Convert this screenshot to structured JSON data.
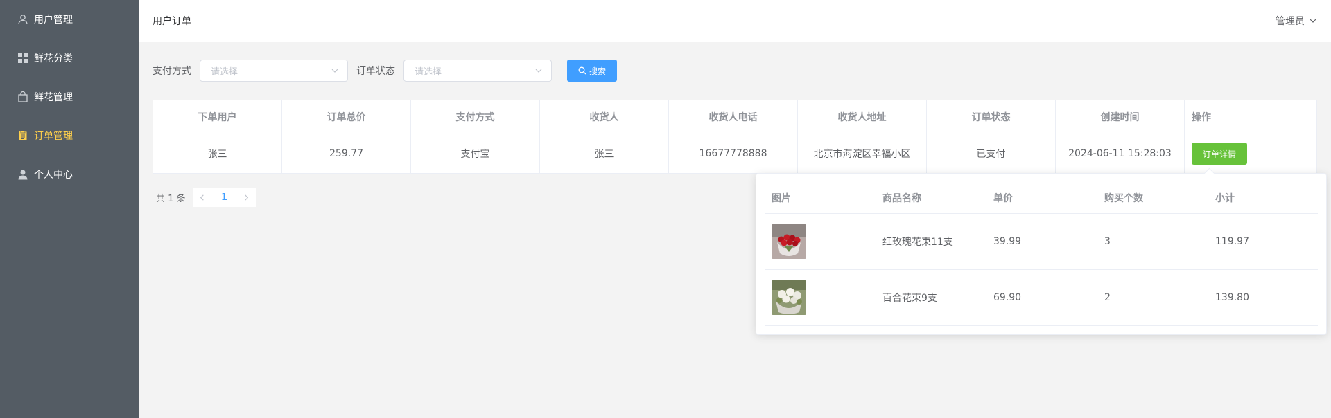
{
  "sidebar": {
    "items": [
      {
        "label": "用户管理",
        "icon": "user-icon",
        "active": false
      },
      {
        "label": "鲜花分类",
        "icon": "grid-icon",
        "active": false
      },
      {
        "label": "鲜花管理",
        "icon": "bag-icon",
        "active": false
      },
      {
        "label": "订单管理",
        "icon": "clipboard-icon",
        "active": true
      },
      {
        "label": "个人中心",
        "icon": "person-icon",
        "active": false
      }
    ]
  },
  "header": {
    "breadcrumb": "用户订单",
    "user_label": "管理员"
  },
  "filters": {
    "pay_method_label": "支付方式",
    "pay_method_placeholder": "请选择",
    "status_label": "订单状态",
    "status_placeholder": "请选择",
    "search_label": "搜索"
  },
  "table": {
    "columns": [
      "下单用户",
      "订单总价",
      "支付方式",
      "收货人",
      "收货人电话",
      "收货人地址",
      "订单状态",
      "创建时间",
      "操作"
    ],
    "rows": [
      {
        "user": "张三",
        "total": "259.77",
        "pay_method": "支付宝",
        "receiver": "张三",
        "phone": "16677778888",
        "address": "北京市海淀区幸福小区",
        "status": "已支付",
        "created": "2024-06-11 15:28:03",
        "action": "订单详情"
      }
    ]
  },
  "pagination": {
    "total_text": "共 1 条",
    "current_page": "1"
  },
  "order_detail": {
    "columns": [
      "图片",
      "商品名称",
      "单价",
      "购买个数",
      "小计"
    ],
    "items": [
      {
        "name": "红玫瑰花束11支",
        "price": "39.99",
        "qty": "3",
        "subtotal": "119.97"
      },
      {
        "name": "百合花束9支",
        "price": "69.90",
        "qty": "2",
        "subtotal": "139.80"
      }
    ]
  },
  "colors": {
    "sidebar_bg": "#545c64",
    "sidebar_active": "#ffd04b",
    "primary": "#409eff",
    "success": "#67c23a"
  }
}
